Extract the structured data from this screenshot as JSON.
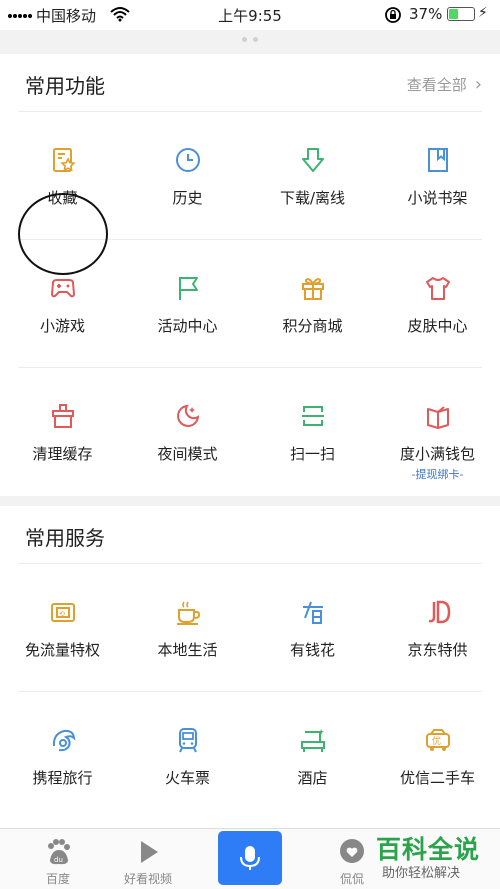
{
  "status_bar": {
    "carrier": "中国移动",
    "time": "上午9:55",
    "battery_percent": "37%",
    "battery_level": 0.37
  },
  "common_functions": {
    "title": "常用功能",
    "view_all": "查看全部",
    "rows": [
      [
        {
          "label": "收藏",
          "icon": "favorite-doc-icon",
          "color": "#e0a030"
        },
        {
          "label": "历史",
          "icon": "clock-icon",
          "color": "#4a90d9"
        },
        {
          "label": "下载/离线",
          "icon": "download-arrow-icon",
          "color": "#3cb371"
        },
        {
          "label": "小说书架",
          "icon": "bookmark-book-icon",
          "color": "#4a90d9"
        }
      ],
      [
        {
          "label": "小游戏",
          "icon": "gamepad-icon",
          "color": "#e05a5a"
        },
        {
          "label": "活动中心",
          "icon": "flag-icon",
          "color": "#3cb371"
        },
        {
          "label": "积分商城",
          "icon": "gift-icon",
          "color": "#e0a030"
        },
        {
          "label": "皮肤中心",
          "icon": "tshirt-icon",
          "color": "#e05a5a"
        }
      ],
      [
        {
          "label": "清理缓存",
          "icon": "broom-icon",
          "color": "#e05a5a"
        },
        {
          "label": "夜间模式",
          "icon": "moon-icon",
          "color": "#e05a5a"
        },
        {
          "label": "扫一扫",
          "icon": "scan-icon",
          "color": "#3cb371"
        },
        {
          "label": "度小满钱包",
          "sub": "-提现绑卡-",
          "icon": "wallet-icon",
          "color": "#e05a5a"
        }
      ]
    ]
  },
  "common_services": {
    "title": "常用服务",
    "rows": [
      [
        {
          "label": "免流量特权",
          "icon": "data-card-icon",
          "color": "#e0a030"
        },
        {
          "label": "本地生活",
          "icon": "coffee-cup-icon",
          "color": "#e0a030"
        },
        {
          "label": "有钱花",
          "icon": "money-glyph-icon",
          "color": "#4a90d9"
        },
        {
          "label": "京东特供",
          "icon": "jd-logo-icon",
          "color": "#e05a5a"
        }
      ],
      [
        {
          "label": "携程旅行",
          "icon": "dolphin-icon",
          "color": "#4a90d9"
        },
        {
          "label": "火车票",
          "icon": "train-icon",
          "color": "#4a90d9"
        },
        {
          "label": "酒店",
          "icon": "bed-icon",
          "color": "#3cb371"
        },
        {
          "label": "优信二手车",
          "icon": "car-deal-icon",
          "color": "#e0a030"
        }
      ]
    ]
  },
  "tabbar": {
    "items": [
      {
        "label": "百度",
        "icon": "paw-icon"
      },
      {
        "label": "好看视频",
        "icon": "play-icon"
      },
      {
        "label": "",
        "icon": "microphone-icon"
      },
      {
        "label": "侃侃",
        "icon": "chat-heart-icon"
      }
    ]
  },
  "watermark": {
    "title": "百科全说",
    "subtitle": "助你轻松解决"
  },
  "colors": {
    "accent_blue": "#2f7df6",
    "link_blue": "#3b73c4",
    "watermark_green": "#2aa44a"
  }
}
